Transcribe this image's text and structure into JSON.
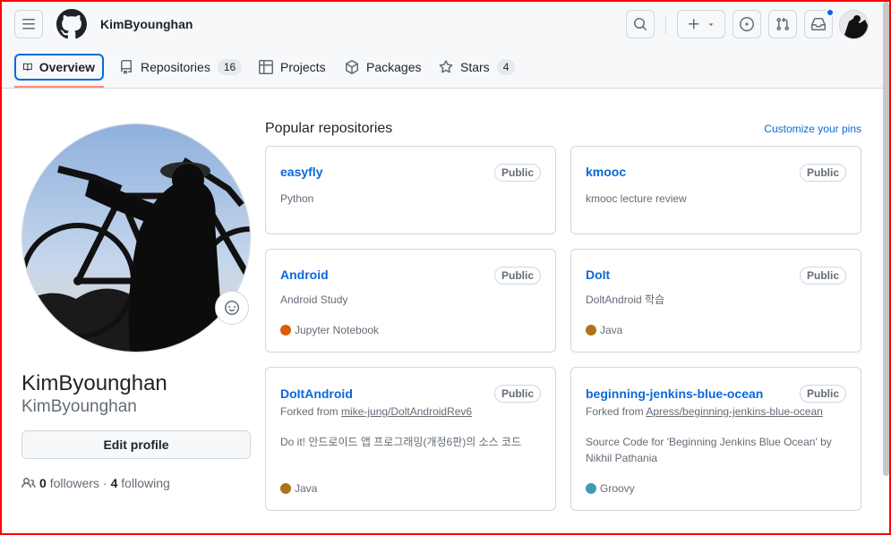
{
  "header": {
    "username": "KimByounghan"
  },
  "tabs": [
    {
      "label": "Overview"
    },
    {
      "label": "Repositories",
      "count": "16"
    },
    {
      "label": "Projects"
    },
    {
      "label": "Packages"
    },
    {
      "label": "Stars",
      "count": "4"
    }
  ],
  "profile": {
    "name": "KimByounghan",
    "login": "KimByounghan",
    "edit_label": "Edit profile",
    "followers": "0",
    "followers_label": "followers",
    "separator": "·",
    "following": "4",
    "following_label": "following"
  },
  "main": {
    "title": "Popular repositories",
    "customize": "Customize your pins"
  },
  "repos": [
    {
      "name": "easyfly",
      "visibility": "Public",
      "desc": "Python"
    },
    {
      "name": "kmooc",
      "visibility": "Public",
      "desc": "kmooc lecture review"
    },
    {
      "name": "Android",
      "visibility": "Public",
      "desc": "Android Study",
      "language": "Jupyter Notebook",
      "color": "#DA5B0B"
    },
    {
      "name": "DoIt",
      "visibility": "Public",
      "desc": "DoltAndroid 학습",
      "language": "Java",
      "color": "#b07219"
    },
    {
      "name": "DoItAndroid",
      "visibility": "Public",
      "fork_prefix": "Forked from",
      "fork_src": "mike-jung/DoltAndroidRev6",
      "desc": "Do it! 안드로이드 앱 프로그래밍(개정6판)의 소스 코드",
      "language": "Java",
      "color": "#b07219"
    },
    {
      "name": "beginning-jenkins-blue-ocean",
      "visibility": "Public",
      "fork_prefix": "Forked from",
      "fork_src": "Apress/beginning-jenkins-blue-ocean",
      "desc": "Source Code for 'Beginning Jenkins Blue Ocean' by Nikhil Pathania",
      "language": "Groovy",
      "color": "#4298b8"
    }
  ]
}
